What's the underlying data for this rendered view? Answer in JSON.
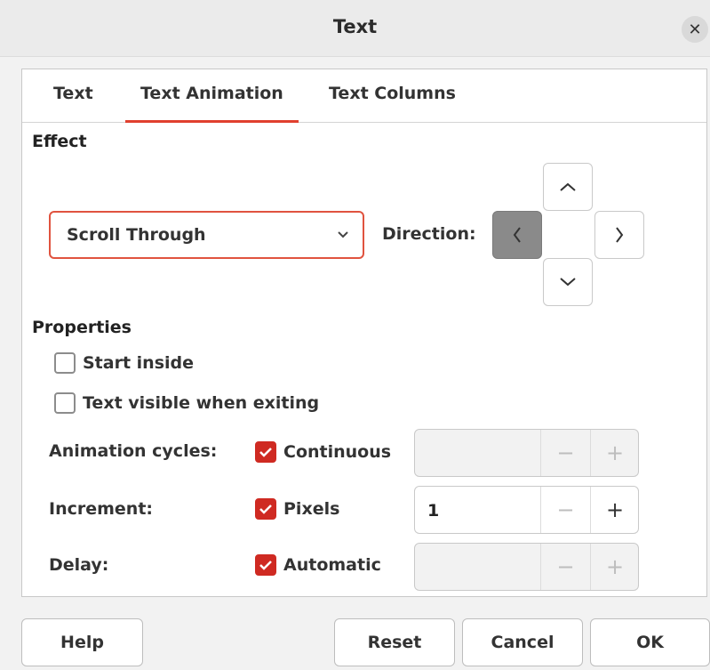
{
  "window": {
    "title": "Text"
  },
  "tabs": [
    {
      "label": "Text",
      "active": false
    },
    {
      "label": "Text Animation",
      "active": true
    },
    {
      "label": "Text Columns",
      "active": false
    }
  ],
  "effect": {
    "section_label": "Effect",
    "selected": "Scroll Through",
    "direction_label": "Direction:",
    "direction_selected": "left"
  },
  "properties": {
    "section_label": "Properties",
    "start_inside": {
      "label": "Start inside",
      "checked": false
    },
    "text_visible": {
      "label": "Text visible when exiting",
      "checked": false
    },
    "animation_cycles": {
      "label": "Animation cycles:",
      "checkbox_label": "Continuous",
      "checked": true,
      "value": ""
    },
    "increment": {
      "label": "Increment:",
      "checkbox_label": "Pixels",
      "checked": true,
      "value": "1"
    },
    "delay": {
      "label": "Delay:",
      "checkbox_label": "Automatic",
      "checked": true,
      "value": ""
    }
  },
  "spin": {
    "minus": "−",
    "plus": "+"
  },
  "buttons": {
    "help": "Help",
    "reset": "Reset",
    "cancel": "Cancel",
    "ok": "OK"
  },
  "colors": {
    "accent": "#e0402e",
    "checkbox": "#cf2a22",
    "selected_direction": "#8a8a8a"
  }
}
